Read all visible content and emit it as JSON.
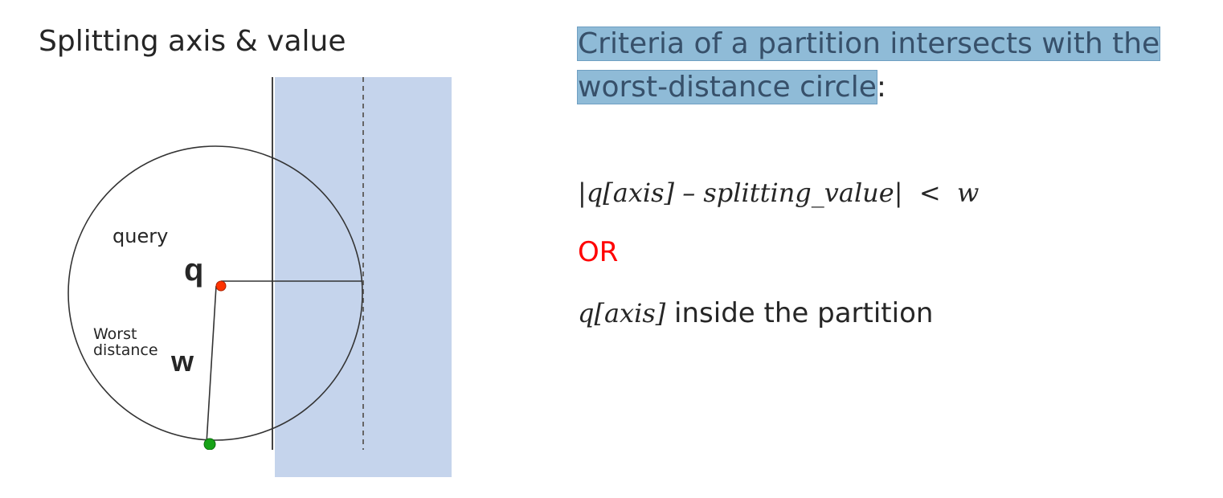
{
  "left": {
    "title": "Splitting axis & value"
  },
  "diagram": {
    "labels": {
      "query": "query",
      "q": "q",
      "worst_line1": "Worst",
      "worst_line2": "distance",
      "w": "w"
    },
    "colors": {
      "partition_fill": "#c5d4ec",
      "query_point": "#ff3300",
      "worst_point": "#17a217"
    }
  },
  "right": {
    "criteria_highlight_line1": "Criteria of a partition intersects with the",
    "criteria_highlight_line2": "worst-distance circle",
    "criteria_suffix": ":",
    "formula": "|q[axis] – splitting_value|  <  w",
    "or_label": "OR",
    "inside_math": "q[axis]",
    "inside_text": "inside the partition"
  }
}
